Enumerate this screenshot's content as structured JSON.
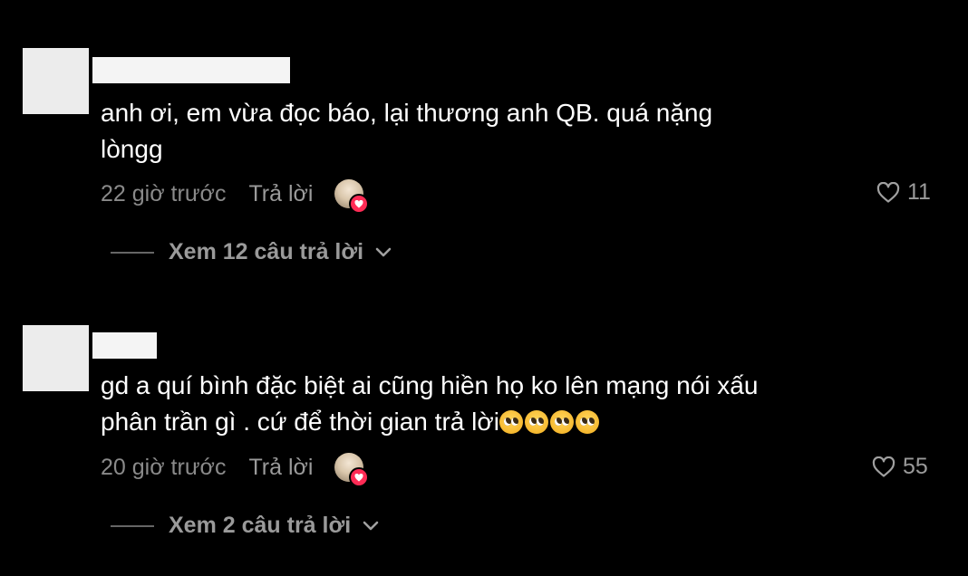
{
  "comments": [
    {
      "text_line1": "anh ơi, em vừa đọc báo, lại thương anh QB. quá nặng",
      "text_line2": "lòngg",
      "timestamp": "22 giờ trước",
      "reply_label": "Trả lời",
      "likes": "11",
      "view_replies": "Xem 12 câu trả lời"
    },
    {
      "text_line1": "gd a quí bình đặc biệt ai cũng hiền họ ko lên mạng nói xấu",
      "text_line2": "phân trần gì . cứ để thời gian trả lời",
      "emoji": [
        "pleading-face",
        "pleading-face",
        "pleading-face",
        "pleading-face"
      ],
      "timestamp": "20 giờ trước",
      "reply_label": "Trả lời",
      "likes": "55",
      "view_replies": "Xem 2 câu trả lời"
    }
  ],
  "icons": {
    "like": "heart-outline-icon",
    "expand": "chevron-down-icon",
    "creator_like_badge": "heart-icon"
  },
  "colors": {
    "background": "#000000",
    "text": "#ffffff",
    "muted": "#8a8a8a",
    "badge": "#ff2b55"
  }
}
